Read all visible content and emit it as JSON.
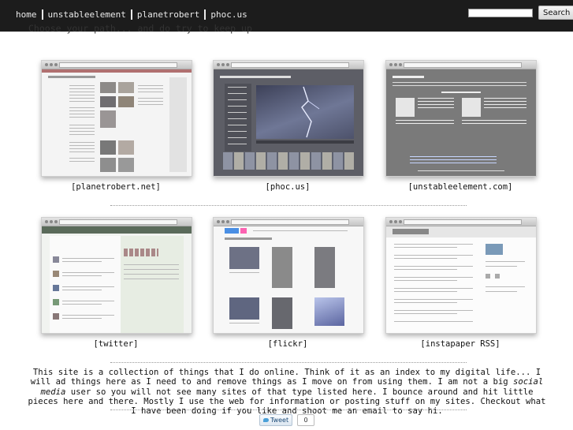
{
  "nav": {
    "links": [
      "home",
      "unstableelement",
      "planetrobert",
      "phoc.us"
    ]
  },
  "search": {
    "value": "",
    "button_label": "Search"
  },
  "tagline": "Choose your path... and do try to keep up",
  "tiles": [
    {
      "caption": "[planetrobert.net]"
    },
    {
      "caption": "[phoc.us]"
    },
    {
      "caption": "[unstableelement.com]"
    },
    {
      "caption": "[twitter]"
    },
    {
      "caption": "[flickr]"
    },
    {
      "caption": "[instapaper RSS]"
    }
  ],
  "about": {
    "part1": "This site is a collection of things that I do online. Think of it as an index to my digital life... I will ad things here as I need to and remove things as I move on from using them. I am not a big ",
    "emphasis": "social media",
    "part2": " user so you will not see many sites of that type listed here. I bounce around and hit little pieces here and there. Mostly I use the web for information or posting stuff on my sites. Checkout what I have been doing if you like and shoot me an email to say hi."
  },
  "tweet": {
    "label": "Tweet",
    "count": "0"
  },
  "colors": {
    "topbar": "#1c1c1c",
    "phocus_bg": "#5d5e66",
    "unstable_bg": "#7a7a7a",
    "flickr_blue": "#0063dc"
  }
}
